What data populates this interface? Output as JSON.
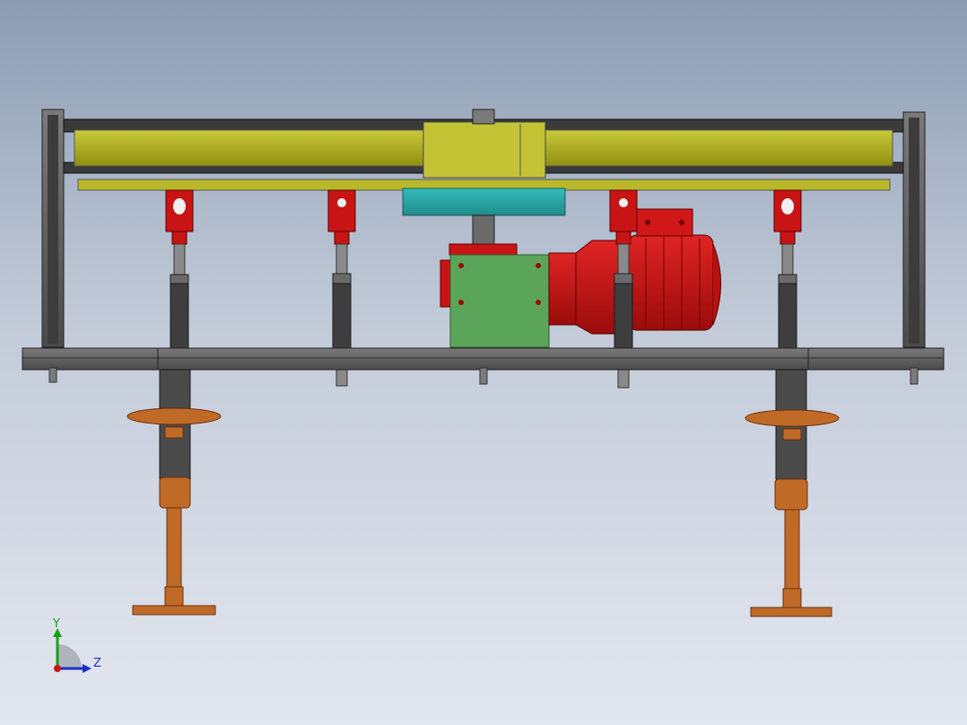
{
  "view": {
    "background_top": "#8c9cb3",
    "background_bottom": "#e3e7ef"
  },
  "colors": {
    "frame": "#5a5a5a",
    "frame_dark": "#2f2f2f",
    "beam_yellow": "#a8a81a",
    "beam_yellow_light": "#c9c93a",
    "pulley_teal": "#2aa5a5",
    "gearbox_green": "#5aa55a",
    "motor_red": "#c81414",
    "handwheel_orange": "#c06a28"
  },
  "components": [
    "frame",
    "yellow-conveyor-beam",
    "teal-pulley",
    "green-gearbox",
    "red-motor",
    "red-clevis-cylinder",
    "handwheel-jack",
    "base-foot"
  ],
  "triad": {
    "y_label": "Y",
    "z_label": "Z",
    "y_color": "#18a018",
    "z_color": "#1830c8",
    "origin_color": "#c81414"
  }
}
